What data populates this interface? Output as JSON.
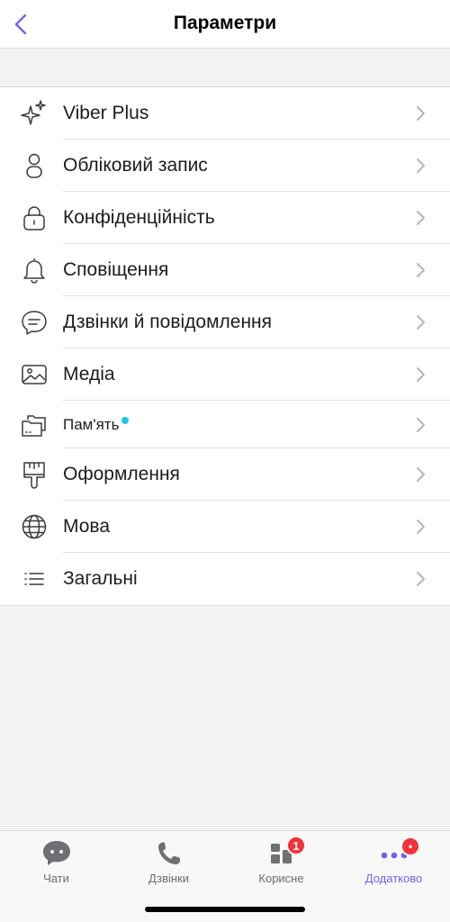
{
  "navbar": {
    "title": "Параметри",
    "back_icon": "chevron-left-icon",
    "accent_color": "#7360f2"
  },
  "settings": {
    "items": [
      {
        "label": "Viber Plus",
        "icon": "sparkles-icon"
      },
      {
        "label": "Обліковий запис",
        "icon": "person-icon"
      },
      {
        "label": "Конфіденційність",
        "icon": "lock-icon"
      },
      {
        "label": "Сповіщення",
        "icon": "bell-icon"
      },
      {
        "label": "Дзвінки й повідомлення",
        "icon": "chat-bubble-icon"
      },
      {
        "label": "Медіа",
        "icon": "image-icon"
      },
      {
        "label": "Пам'ять",
        "icon": "folders-icon",
        "has_dot": true,
        "dot_color": "#22c2f0"
      },
      {
        "label": "Оформлення",
        "icon": "paintbrush-icon"
      },
      {
        "label": "Мова",
        "icon": "globe-icon"
      },
      {
        "label": "Загальні",
        "icon": "list-icon"
      }
    ]
  },
  "tabbar": {
    "tabs": [
      {
        "label": "Чати",
        "icon": "chat-icon",
        "active": false
      },
      {
        "label": "Дзвінки",
        "icon": "phone-icon",
        "active": false
      },
      {
        "label": "Корисне",
        "icon": "grid-icon",
        "active": false,
        "badge": "1"
      },
      {
        "label": "Додатково",
        "icon": "more-icon",
        "active": true,
        "badge": "•"
      }
    ],
    "badge_color": "#f2333a",
    "active_color": "#7360f2"
  }
}
